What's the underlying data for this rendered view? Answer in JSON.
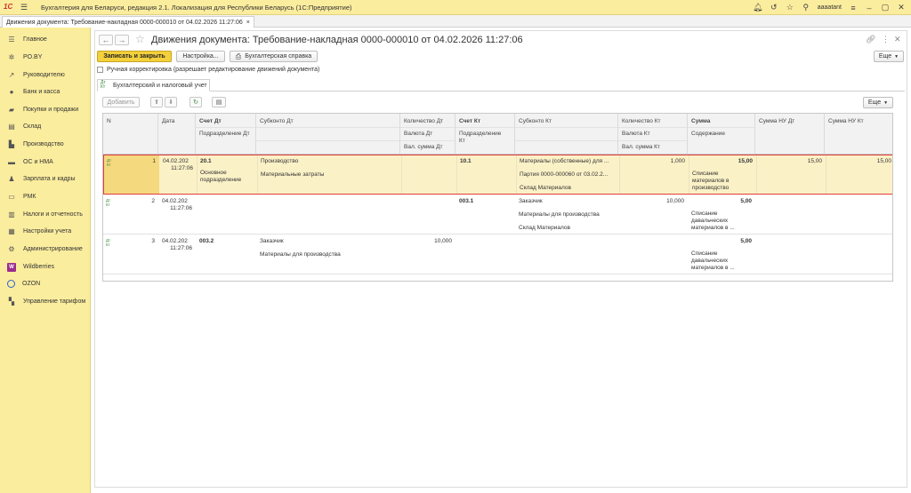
{
  "app": {
    "title": "Бухгалтерия для Беларуси, редакция 2.1. Локализация для Республики Беларусь   (1С:Предприятие)",
    "logo": "1С",
    "username": "aaaatant",
    "brand_color": "#fbed9e"
  },
  "tab": {
    "label": "Движения документа: Требование-накладная 0000-000010 от 04.02.2026 11:27:06",
    "close": "×"
  },
  "sidebar": {
    "items": [
      {
        "label": "Главное",
        "icon": "menu-icon",
        "glyph": "☰"
      },
      {
        "label": "PO.BY",
        "icon": "sun-icon",
        "glyph": "✲"
      },
      {
        "label": "Руководителю",
        "icon": "trend-icon",
        "glyph": "↗"
      },
      {
        "label": "Банк и касса",
        "icon": "coin-icon",
        "glyph": "●"
      },
      {
        "label": "Покупки и продажи",
        "icon": "cart-icon",
        "glyph": "▰"
      },
      {
        "label": "Склад",
        "icon": "warehouse-icon",
        "glyph": "▤"
      },
      {
        "label": "Производство",
        "icon": "factory-icon",
        "glyph": "▙"
      },
      {
        "label": "ОС и НМА",
        "icon": "truck-icon",
        "glyph": "▬"
      },
      {
        "label": "Зарплата и кадры",
        "icon": "person-icon",
        "glyph": "♟"
      },
      {
        "label": "РМК",
        "icon": "register-icon",
        "glyph": "▭"
      },
      {
        "label": "Налоги и отчетность",
        "icon": "chart-icon",
        "glyph": "▥"
      },
      {
        "label": "Настройки учета",
        "icon": "settings-icon",
        "glyph": "▦"
      },
      {
        "label": "Администрирование",
        "icon": "gear-icon",
        "glyph": "⚙"
      },
      {
        "label": "Wildberries",
        "icon": "wildberries-icon",
        "glyph": "W"
      },
      {
        "label": "OZON",
        "icon": "ozon-icon",
        "glyph": ""
      },
      {
        "label": "Управление тарифом",
        "icon": "tariff-icon",
        "glyph": "▚"
      }
    ]
  },
  "header": {
    "title": "Движения документа: Требование-накладная 0000-000010 от 04.02.2026 11:27:06",
    "back": "←",
    "forward": "→"
  },
  "toolbar": {
    "save_close": "Записать и закрыть",
    "settings": "Настройка...",
    "report": "Бухгалтерская справка",
    "more": "Еще"
  },
  "manual_correction": "Ручная корректировка (разрешает редактирование движений документа)",
  "subtab": {
    "label": "Бухгалтерский и налоговый учет"
  },
  "table_toolbar": {
    "add": "Добавить",
    "more": "Еще"
  },
  "columns": {
    "n": "N",
    "date": "Дата",
    "account_dt": "Счет Дт",
    "subdivision_dt": "Подразделение Дт",
    "subconto_dt": "Субконто Дт",
    "qty_dt": "Количество Дт",
    "currency_dt": "Валюта Дт",
    "cur_sum_dt": "Вал. сумма Дт",
    "account_kt": "Счет Кт",
    "subdivision_kt": "Подразделение Кт",
    "subconto_kt": "Субконто Кт",
    "qty_kt": "Количество Кт",
    "currency_kt": "Валюта Кт",
    "cur_sum_kt": "Вал. сумма Кт",
    "sum": "Сумма",
    "content": "Содержание",
    "sum_nu_dt": "Сумма НУ Дт",
    "sum_nu_kt": "Сумма НУ Кт"
  },
  "rows": [
    {
      "n": "1",
      "date": "04.02.202",
      "time": "11:27:06",
      "account_dt": "20.1",
      "subdivision_dt": "Основное подразделение",
      "subconto_dt": [
        "Производство",
        "Материальные затраты"
      ],
      "qty_dt": "",
      "account_kt": "10.1",
      "subconto_kt": [
        "Материалы (собственные) для ...",
        "Партия 0000-000060 от 03.02.2...",
        "Склад Материалов"
      ],
      "qty_kt": "1,000",
      "sum": "15,00",
      "content": "Списание материалов в производство",
      "sum_nu_dt": "15,00",
      "sum_nu_kt": "15,00"
    },
    {
      "n": "2",
      "date": "04.02.202",
      "time": "11:27:06",
      "account_dt": "",
      "subdivision_dt": "",
      "subconto_dt": [
        "",
        ""
      ],
      "qty_dt": "",
      "account_kt": "003.1",
      "subconto_kt": [
        "Заказчик",
        "Материалы для производства",
        "Склад Материалов"
      ],
      "qty_kt": "10,000",
      "sum": "5,00",
      "content": "Списание давальческих материалов в ...",
      "sum_nu_dt": "",
      "sum_nu_kt": ""
    },
    {
      "n": "3",
      "date": "04.02.202",
      "time": "11:27:06",
      "account_dt": "003.2",
      "subdivision_dt": "",
      "subconto_dt": [
        "Заказчик",
        "Материалы для производства"
      ],
      "qty_dt": "10,000",
      "account_kt": "",
      "subconto_kt": [
        "",
        "",
        ""
      ],
      "qty_kt": "",
      "sum": "5,00",
      "content": "Списание давальческих материалов в ...",
      "sum_nu_dt": "",
      "sum_nu_kt": ""
    }
  ],
  "icons": {
    "row_icon_top": "Дт",
    "row_icon_bottom": "Кт"
  }
}
